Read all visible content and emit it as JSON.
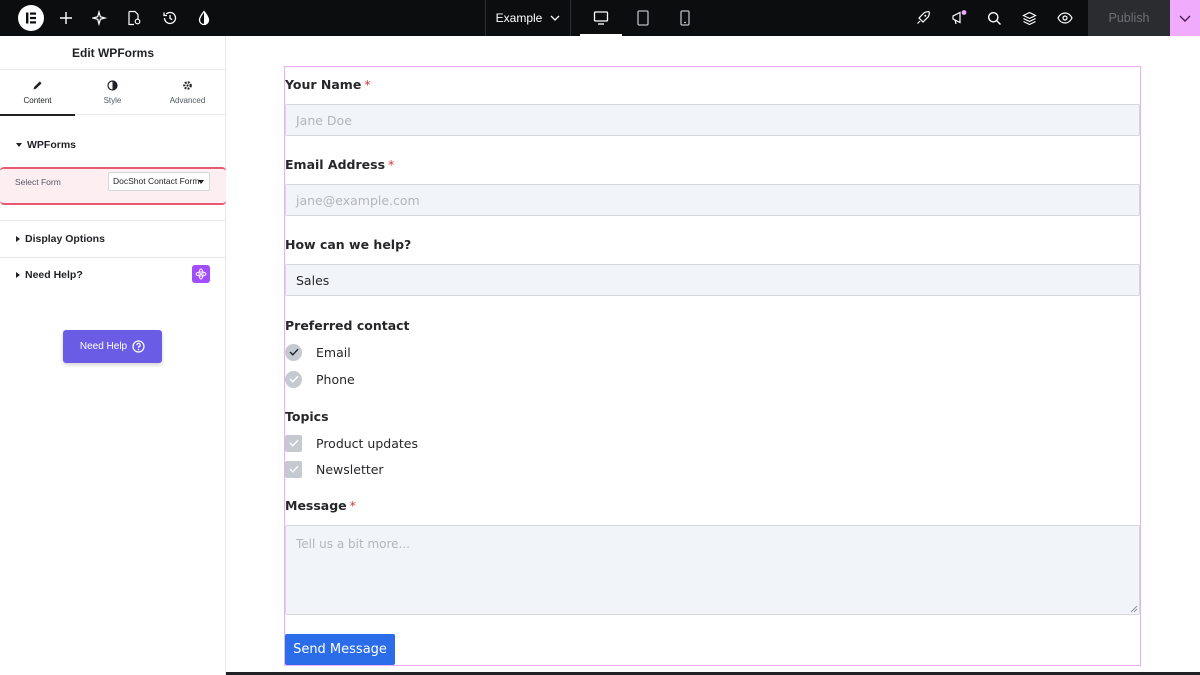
{
  "topbar": {
    "page_name": "Example",
    "publish_label": "Publish",
    "accent_color": "#f0abfc"
  },
  "panel": {
    "title": "Edit WPForms",
    "tabs": [
      {
        "label": "Content",
        "icon": "pencil-icon",
        "active": true
      },
      {
        "label": "Style",
        "icon": "contrast-icon",
        "active": false
      },
      {
        "label": "Advanced",
        "icon": "gear-icon",
        "active": false
      }
    ],
    "section_wpforms": "WPForms",
    "select_form_label": "Select Form",
    "select_form_value": "DocShot Contact Form",
    "section_display": "Display Options",
    "section_help": "Need Help?",
    "need_help_button": "Need Help"
  },
  "form": {
    "name_label": "Your Name",
    "name_placeholder": "Jane Doe",
    "email_label": "Email Address",
    "email_placeholder": "jane@example.com",
    "help_label": "How can we help?",
    "help_value": "Sales",
    "contact_label": "Preferred contact",
    "contact_options": [
      "Email",
      "Phone"
    ],
    "topics_label": "Topics",
    "topic_options": [
      "Product updates",
      "Newsletter"
    ],
    "message_label": "Message",
    "message_placeholder": "Tell us a bit more...",
    "required_marker": "*",
    "submit_label": "Send Message",
    "button_color": "#2b6de8"
  }
}
